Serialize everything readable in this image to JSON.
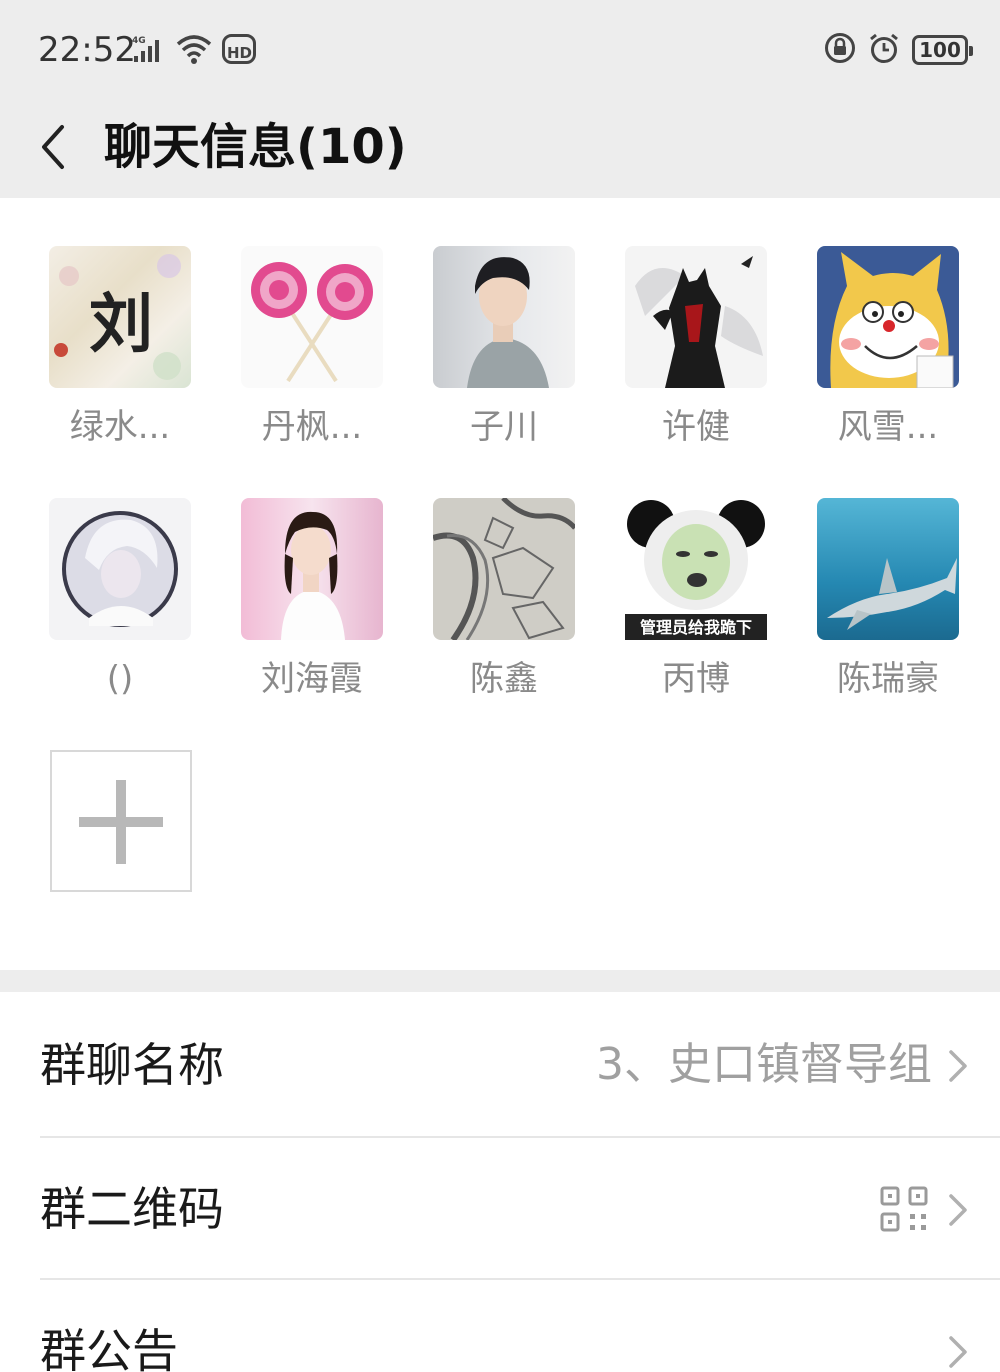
{
  "status_bar": {
    "time": "22:52",
    "network_label": "4G",
    "hd_label": "HD",
    "battery": "100",
    "icons": [
      "signal-icon",
      "wifi-icon",
      "hd-icon",
      "lock-icon",
      "alarm-icon",
      "battery-icon"
    ]
  },
  "nav": {
    "title": "聊天信息(10)",
    "back_icon": "back-arrow-icon"
  },
  "members": [
    {
      "name": "绿水...",
      "avatar_text": "刘"
    },
    {
      "name": "丹枫...",
      "avatar_text": ""
    },
    {
      "name": "子川",
      "avatar_text": ""
    },
    {
      "name": "许健",
      "avatar_text": ""
    },
    {
      "name": "风雪...",
      "avatar_text": ""
    },
    {
      "name": "()",
      "avatar_text": ""
    },
    {
      "name": "刘海霞",
      "avatar_text": ""
    },
    {
      "name": "陈鑫",
      "avatar_text": ""
    },
    {
      "name": "丙博",
      "avatar_text": "管理员给我跪下"
    },
    {
      "name": "陈瑞豪",
      "avatar_text": ""
    }
  ],
  "add_member_icon": "plus-icon",
  "settings": {
    "group_name_label": "群聊名称",
    "group_name_value": "3、史口镇督导组",
    "qr_label": "群二维码",
    "notice_label": "群公告"
  },
  "colors": {
    "header_bg": "#ededed",
    "secondary_text": "#8a8a8a"
  }
}
